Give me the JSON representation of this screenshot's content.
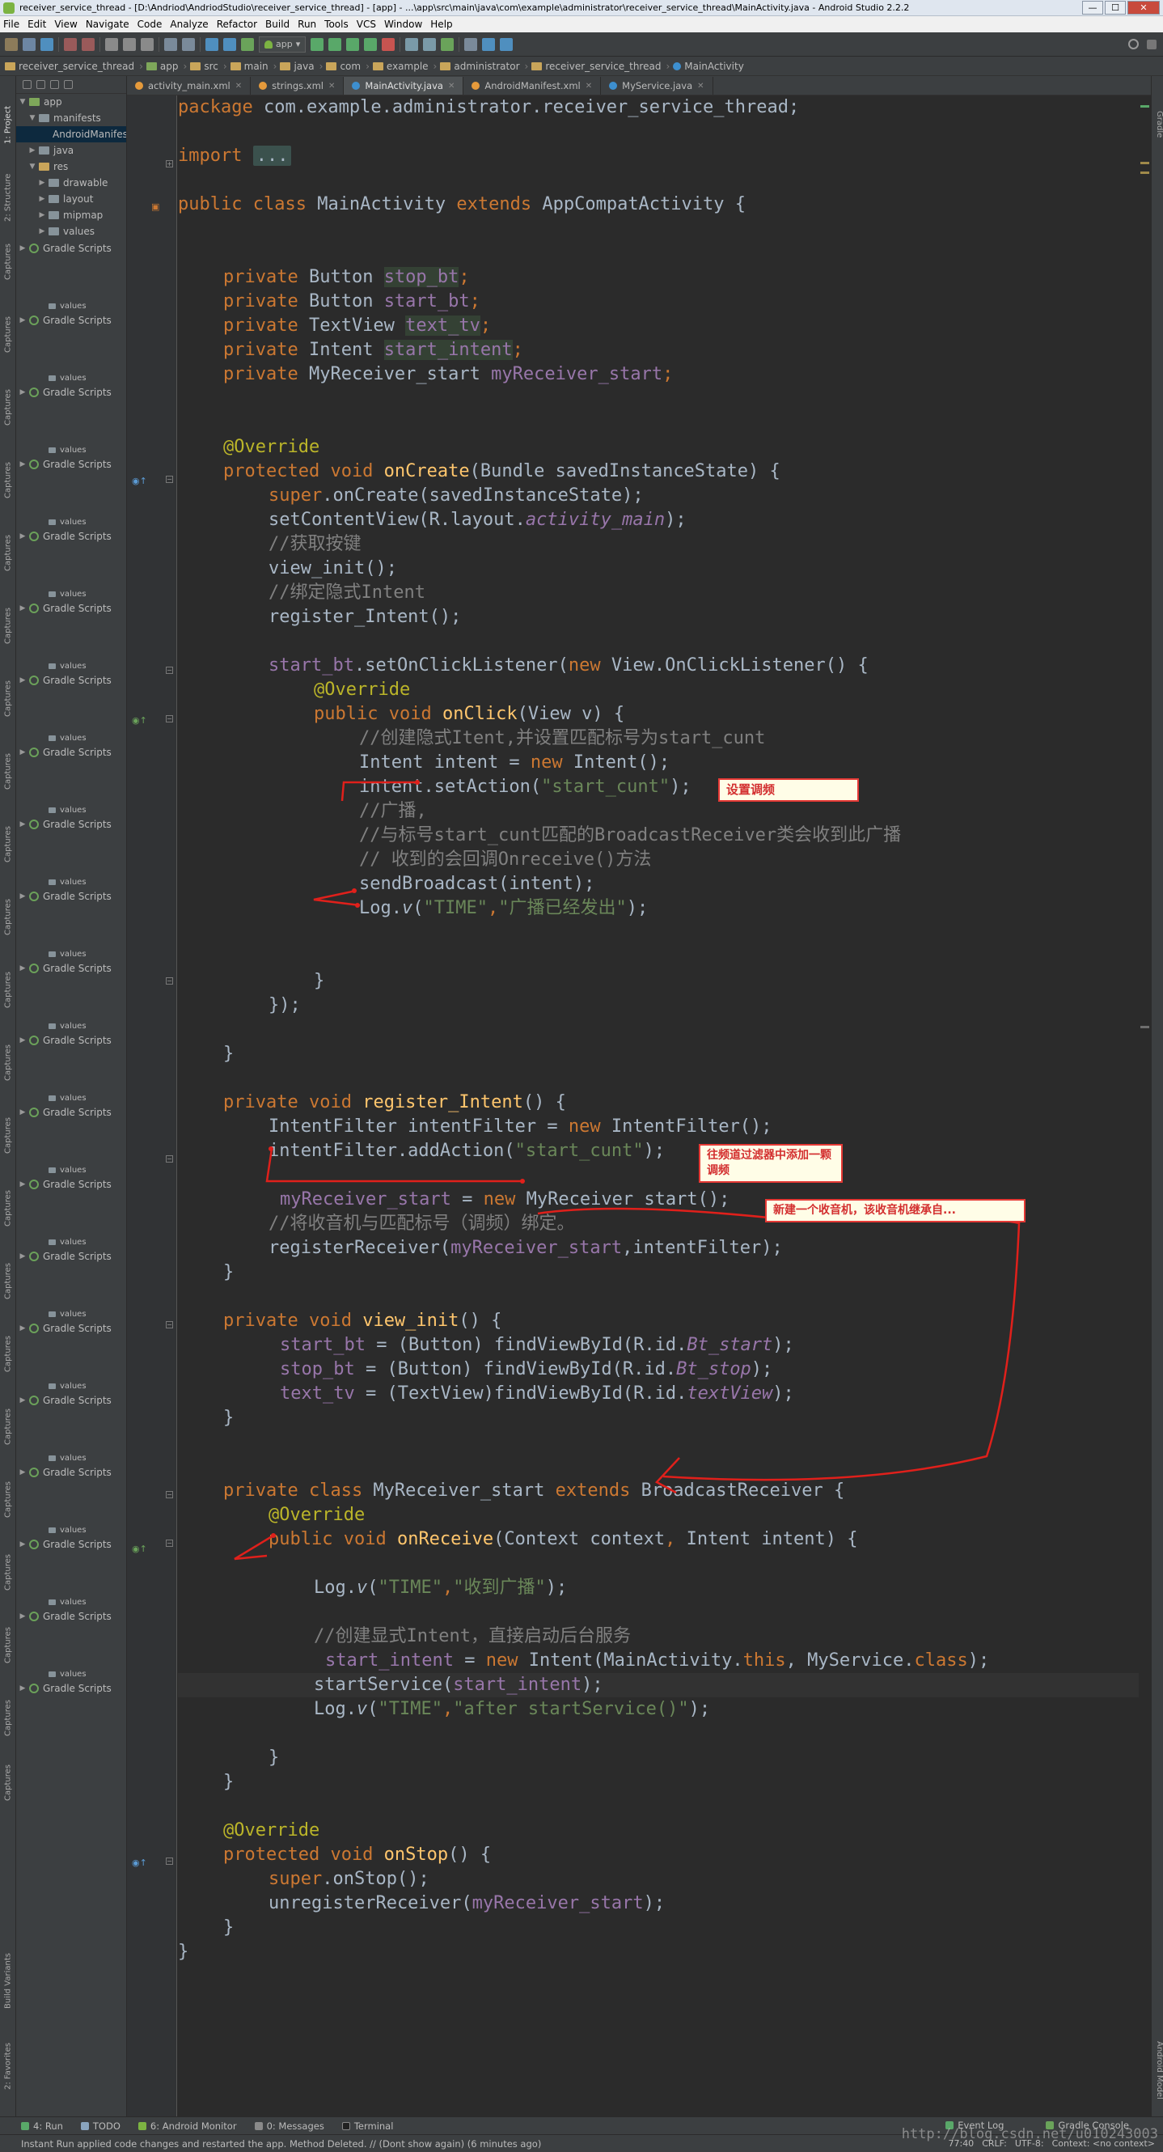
{
  "window": {
    "title": "receiver_service_thread - [D:\\Andriod\\AndriodStudio\\receiver_service_thread] - [app] - ...\\app\\src\\main\\java\\com\\example\\administrator\\receiver_service_thread\\MainActivity.java - Android Studio 2.2.2",
    "minimize": "—",
    "maximize": "☐",
    "close": "✕"
  },
  "menu": [
    "File",
    "Edit",
    "View",
    "Navigate",
    "Code",
    "Analyze",
    "Refactor",
    "Build",
    "Run",
    "Tools",
    "VCS",
    "Window",
    "Help"
  ],
  "toolbar": {
    "run_config": "app"
  },
  "breadcrumb": [
    "receiver_service_thread",
    "app",
    "src",
    "main",
    "java",
    "com",
    "example",
    "administrator",
    "receiver_service_thread",
    "MainActivity"
  ],
  "tabs": [
    {
      "label": "activity_main.xml",
      "color": "#e59a3b"
    },
    {
      "label": "strings.xml",
      "color": "#e59a3b"
    },
    {
      "label": "MainActivity.java",
      "color": "#3d8fcf"
    },
    {
      "label": "AndroidManifest.xml",
      "color": "#e59a3b"
    },
    {
      "label": "MyService.java",
      "color": "#3d8fcf"
    }
  ],
  "left_stripe": {
    "project": "1: Project",
    "structure": "2: Structure",
    "captures": "Captures",
    "build_variants": "Build Variants",
    "favorites": "2: Favorites"
  },
  "right_stripe": {
    "gradle": "Gradle",
    "android_model": "Android Model"
  },
  "project_tree": {
    "root": "app",
    "manifests": "manifests",
    "manifest_file": "AndroidManifest.xml",
    "java": "java",
    "res": "res",
    "res_children": [
      "drawable",
      "layout",
      "mipmap",
      "values"
    ],
    "gradle": "Gradle Scripts",
    "values": "values"
  },
  "code": {
    "l1_package": "package",
    "l1_name": " com.example.administrator.receiver_service_thread;",
    "l2_import": "import",
    "l2_folded": "...",
    "l3_public": "public class",
    "l3_name": " MainActivity ",
    "l3_extends": "extends",
    "l3_super": " AppCompatActivity {",
    "f_private": "private",
    "f1_type": " Button ",
    "f1_name": "stop_bt",
    "f2_type": " Button ",
    "f2_name": "start_bt",
    "f3_type": " TextView ",
    "f3_name": "text_tv",
    "f4_type": " Intent ",
    "f4_name": "start_intent",
    "f5_type": " MyReceiver_start ",
    "f5_name": "myReceiver_start",
    "semi": ";",
    "override": "@Override",
    "oncreate_mod": "protected void",
    "oncreate_name": " onCreate",
    "oncreate_params": "(Bundle savedInstanceState) {",
    "super_kw": "super",
    "super_call": ".onCreate(savedInstanceState);",
    "setcontent_a": "setContentView(R.layout.",
    "setcontent_b": "activity_main",
    "setcontent_c": ");",
    "c_get_btn": "//获取按键",
    "view_init_call": "view_init();",
    "c_bind": "//绑定隐式Intent",
    "register_call": "register_Intent();",
    "startbt": "start_bt",
    "setlistener_a": ".setOnClickListener(",
    "new_kw": "new",
    "setlistener_b": " View.OnClickListener() {",
    "onclick_mod": "public void",
    "onclick_name": " onClick",
    "onclick_params": "(View v) {",
    "c_create": "//创建隐式Itent,并设置匹配标号为start_cunt",
    "intent_decl_a": "Intent intent = ",
    "intent_decl_b": " Intent();",
    "setaction_a": "intent.setAction(",
    "setaction_str": "\"start_cunt\"",
    "close_paren_semi": ");",
    "c_broadcast": "//广播,",
    "c_match": "//与标号start_cunt匹配的BroadcastReceiver类会收到此广播",
    "c_callback": "// 收到的会回调Onreceive()方法",
    "sendbroadcast": "sendBroadcast(intent);",
    "log_a": "Log.",
    "log_v": "v",
    "log_paren": "(",
    "log_time": "\"TIME\"",
    "comma": ",",
    "log_sent": "\"广播已经发出\"",
    "brace_close": "}",
    "close_anon": "});",
    "reg_mod": "private void",
    "reg_name": " register_Intent",
    "reg_params": "() {",
    "filter_a": "IntentFilter intentFilter = ",
    "filter_b": " IntentFilter();",
    "addaction_a": "intentFilter.addAction(",
    "myrec_name": "myReceiver_start",
    "myrec_assign": " = ",
    "myrec_type": " MyReceiver_start();",
    "c_bind_radio": "//将收音机与匹配标号（调频）绑定。",
    "registerreceiver_a": "registerReceiver(",
    "registerreceiver_b": ",intentFilter);",
    "vinit_mod": "private void",
    "vinit_name": " view_init",
    "vinit_params": "() {",
    "find1_a": " = (Button) findViewById(R.id.",
    "find1_id": "Bt_start",
    "stopbt": "stop_bt",
    "find2_id": "Bt_stop",
    "texttv": "text_tv",
    "find3_a": " = (TextView)findViewById(R.id.",
    "find3_id": "textView",
    "cls_mod": "private class",
    "cls_name": " MyReceiver_start ",
    "cls_extends": "extends",
    "cls_super": " BroadcastReceiver {",
    "onreceive_mod": "public void",
    "onreceive_name": " onReceive",
    "onreceive_p1": "(Context context",
    "onreceive_p2": " Intent intent) {",
    "log_recv": "\"收到广播\"",
    "c_explicit": "//创建显式Intent，直接启动后台服务",
    "startintent": "start_intent",
    "explicit_a": " Intent(MainActivity.",
    "this_kw": "this",
    "explicit_b": ", MyService.",
    "class_kw": "class",
    "startservice_a": "startService(",
    "log_after": "\"after startService()\"",
    "onstop_mod": "protected void",
    "onstop_name": " onStop",
    "onstop_params": "() {",
    "super_stop": ".onStop();",
    "unregister_a": "unregisterReceiver(",
    "unregister_b": ");"
  },
  "annotations": {
    "note1": "设置调频",
    "note2": "往频道过滤器中添加一颗调频",
    "note3": "新建一个收音机，该收音机继承自..."
  },
  "bottom_tools": [
    "4: Run",
    "TODO",
    "6: Android Monitor",
    "0: Messages",
    "Terminal"
  ],
  "bottom_right": [
    "Event Log",
    "Gradle Console"
  ],
  "status": {
    "message": "Instant Run applied code changes and restarted the app. Method Deleted. // (Dont show again) (6 minutes ago)",
    "position": "77:40",
    "line_sep": "CRLF:",
    "encoding": "UTF-8:",
    "context": "Context: <no context>",
    "watermark": "http://blog.csdn.net/u010243003"
  },
  "colors": {
    "editor_bg": "#2b2b2b",
    "keyword": "#cc7832",
    "string": "#6a8759",
    "comment": "#808080",
    "field": "#9876aa",
    "method": "#ffc66d",
    "annotation": "#bbb529",
    "note_border": "#e53935"
  }
}
